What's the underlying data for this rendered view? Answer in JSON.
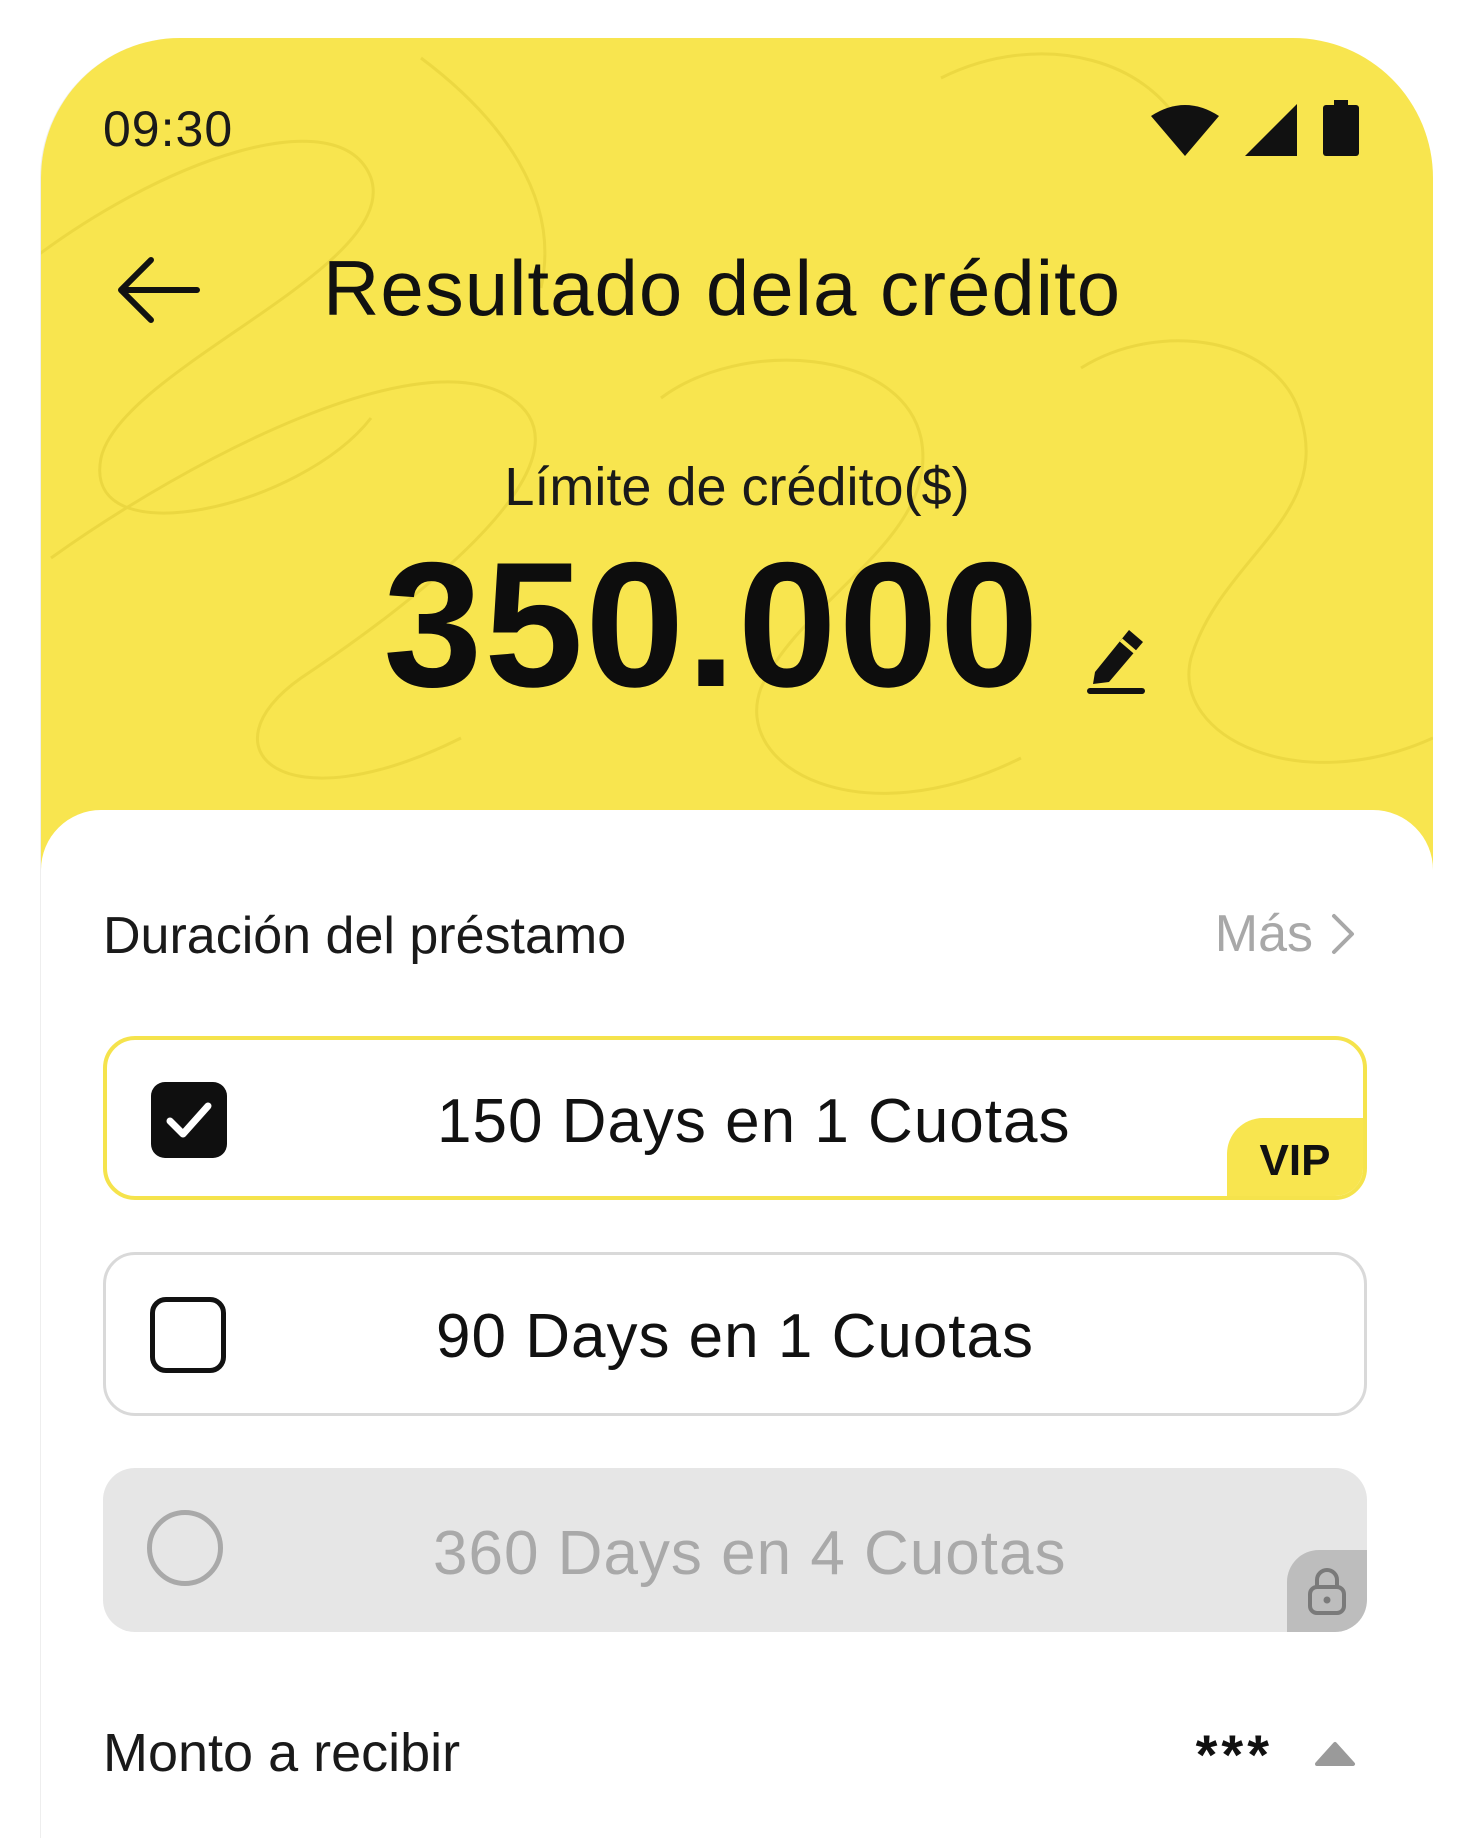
{
  "status_bar": {
    "time": "09:30",
    "icons": [
      "wifi-icon",
      "signal-icon",
      "battery-icon"
    ]
  },
  "header": {
    "title": "Resultado dela crédito",
    "back_icon": "arrow-left-icon",
    "background_color": "#f8e54f"
  },
  "credit_limit": {
    "label": "Límite de crédito($)",
    "value": "350.000",
    "edit_icon": "pencil-icon"
  },
  "loan_duration": {
    "title": "Duración del préstamo",
    "more_label": "Más",
    "options": [
      {
        "label": "150 Days en 1 Cuotas",
        "state": "checked",
        "badge": "VIP"
      },
      {
        "label": "90 Days en 1 Cuotas",
        "state": "unchecked",
        "badge": ""
      },
      {
        "label": "360 Days en 4 Cuotas",
        "state": "locked",
        "badge": "lock-icon"
      }
    ]
  },
  "amount": {
    "label": "Monto a recibir",
    "value": "***",
    "toggle_icon": "caret-up-icon"
  }
}
